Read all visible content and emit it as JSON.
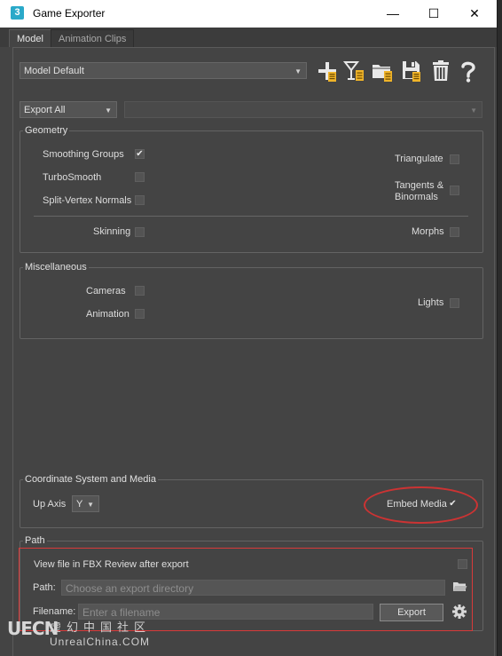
{
  "window": {
    "app_icon_text": "3",
    "title": "Game Exporter",
    "minimize_glyph": "—",
    "maximize_glyph": "☐",
    "close_glyph": "✕"
  },
  "tabs": [
    {
      "label": "Model",
      "active": true
    },
    {
      "label": "Animation Clips",
      "active": false
    }
  ],
  "preset": {
    "value": "Model Default"
  },
  "toolbar_icons": [
    "add-preset-icon",
    "rename-preset-icon",
    "load-preset-icon",
    "save-preset-icon",
    "delete-preset-icon",
    "help-icon"
  ],
  "export_mode": {
    "value": "Export All"
  },
  "geometry": {
    "title": "Geometry",
    "smoothing_groups": {
      "label": "Smoothing Groups",
      "checked": true
    },
    "turbosmooth": {
      "label": "TurboSmooth",
      "checked": false
    },
    "split_vertex_normals": {
      "label": "Split-Vertex Normals",
      "checked": false
    },
    "triangulate": {
      "label": "Triangulate",
      "checked": false
    },
    "tangents_line1": "Tangents &",
    "tangents_line2": "Binormals",
    "tangents_checked": false,
    "skinning": {
      "label": "Skinning",
      "checked": false
    },
    "morphs": {
      "label": "Morphs",
      "checked": false
    }
  },
  "misc": {
    "title": "Miscellaneous",
    "cameras": {
      "label": "Cameras",
      "checked": false
    },
    "animation": {
      "label": "Animation",
      "checked": false
    },
    "lights": {
      "label": "Lights",
      "checked": false
    }
  },
  "coord": {
    "title": "Coordinate System and Media",
    "up_axis_label": "Up Axis",
    "up_axis_value": "Y",
    "embed_media": {
      "label": "Embed Media",
      "checked": true
    }
  },
  "path": {
    "title": "Path",
    "view_fbx_label": "View file in FBX Review after export",
    "view_fbx_checked": false,
    "path_label": "Path:",
    "path_placeholder": "Choose an export directory",
    "filename_label": "Filename:",
    "filename_placeholder": "Enter a filename",
    "export_button": "Export"
  },
  "watermark": {
    "logo": "UECN",
    "chinese": "虚幻中国社区",
    "english": "UnrealChina.COM"
  },
  "colors": {
    "window_bg": "#444444",
    "accent_red": "#d93a3a",
    "app_icon_teal": "#2aa9c9",
    "icon_gold": "#f0b429"
  }
}
